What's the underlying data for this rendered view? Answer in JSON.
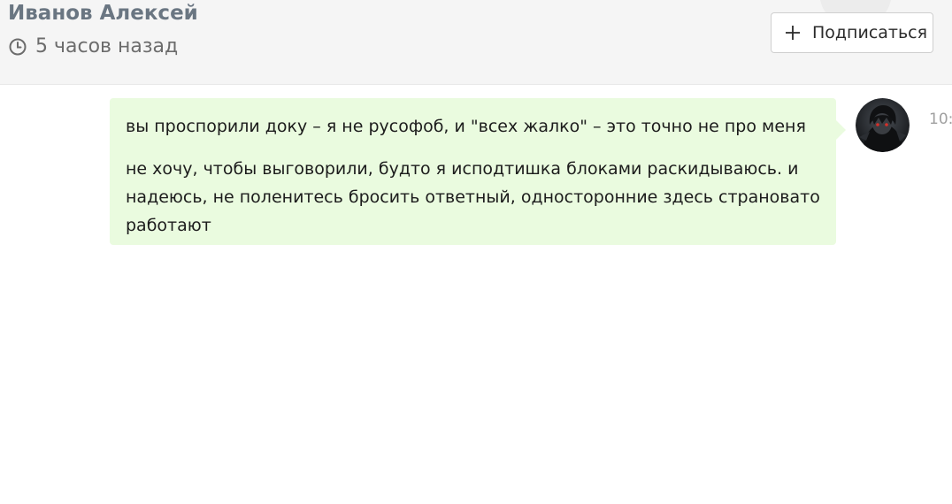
{
  "header": {
    "author_name": "Иванов Алексей",
    "timestamp": "5 часов назад",
    "subscribe_label": "Подписаться",
    "icons": {
      "clock": "clock-icon",
      "plus": "plus-icon"
    }
  },
  "message": {
    "paragraphs": [
      "вы проспорили доку – я не русофоб, и \"всех жалко\" – это точно не про меня",
      "не хочу, чтобы выговорили, будто я исподтишка блоками раскидываюсь. и надеюсь, не поленитесь бросить ответный, односторонние здесь страновато работают"
    ],
    "time": "10:"
  },
  "colors": {
    "header_background": "#f5f5f5",
    "author_name": "#6a7682",
    "bubble_background": "#eafbdf"
  }
}
